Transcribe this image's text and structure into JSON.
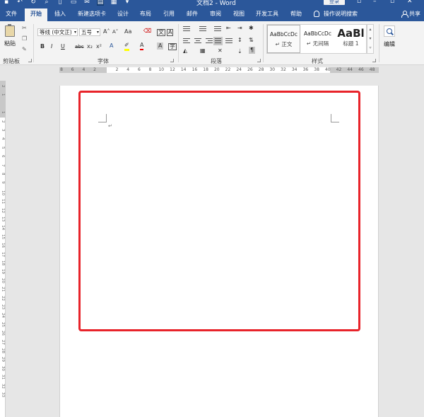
{
  "title_bar": {
    "doc_title": "文档2 - Word",
    "login_label": "登录",
    "qat_icons": [
      "save-icon",
      "undo-icon",
      "redo-icon",
      "print-preview-icon",
      "new-doc-icon",
      "open-icon",
      "email-icon",
      "print-icon",
      "quick-print-icon",
      "dropdown-icon"
    ]
  },
  "tabs": {
    "file": "文件",
    "home": "开始",
    "insert": "插入",
    "new_tab": "新建选项卡",
    "design": "设计",
    "layout": "布局",
    "references": "引用",
    "mailings": "邮件",
    "review": "审阅",
    "view": "视图",
    "developer": "开发工具",
    "help": "帮助",
    "tell_me": "操作说明搜索",
    "share": "共享"
  },
  "ribbon": {
    "clipboard": {
      "paste_label": "粘贴",
      "group_label": "剪贴板"
    },
    "font": {
      "font_name": "等线 (中文正)",
      "font_size": "五号",
      "grow": "A˄",
      "shrink": "A˅",
      "case": "Aa",
      "bold": "B",
      "italic": "I",
      "underline": "U",
      "strike": "abc",
      "subscript": "x₂",
      "superscript": "x²",
      "group_label": "字体"
    },
    "paragraph": {
      "group_label": "段落"
    },
    "styles": {
      "items": [
        {
          "preview": "AaBbCcDc",
          "name": "↵ 正文"
        },
        {
          "preview": "AaBbCcDc",
          "name": "↵ 无间隔"
        },
        {
          "preview": "AaBl",
          "name": "标题 1"
        }
      ],
      "group_label": "样式"
    },
    "editing": {
      "label": "编辑"
    }
  },
  "ruler": {
    "h_numbers": [
      "8",
      "6",
      "4",
      "2",
      "",
      "2",
      "4",
      "6",
      "8",
      "10",
      "12",
      "14",
      "16",
      "18",
      "20",
      "22",
      "24",
      "26",
      "28",
      "30",
      "32",
      "34",
      "36",
      "38",
      "40",
      "42",
      "44",
      "46",
      "48"
    ],
    "v_numbers": [
      "2",
      "1",
      "",
      "1",
      "2",
      "3",
      "4",
      "5",
      "6",
      "7",
      "8",
      "9",
      "10",
      "11",
      "12",
      "13",
      "14",
      "15",
      "16",
      "17",
      "18",
      "19",
      "20",
      "21",
      "22",
      "23",
      "24",
      "25",
      "26",
      "27",
      "28",
      "29",
      "30",
      "31",
      "32",
      "33"
    ]
  },
  "document": {
    "paragraph_mark": "↵"
  },
  "colors": {
    "title_bar": "#2b579a",
    "ribbon_bg": "#f3f3f3",
    "highlight_border": "#e8232a"
  }
}
